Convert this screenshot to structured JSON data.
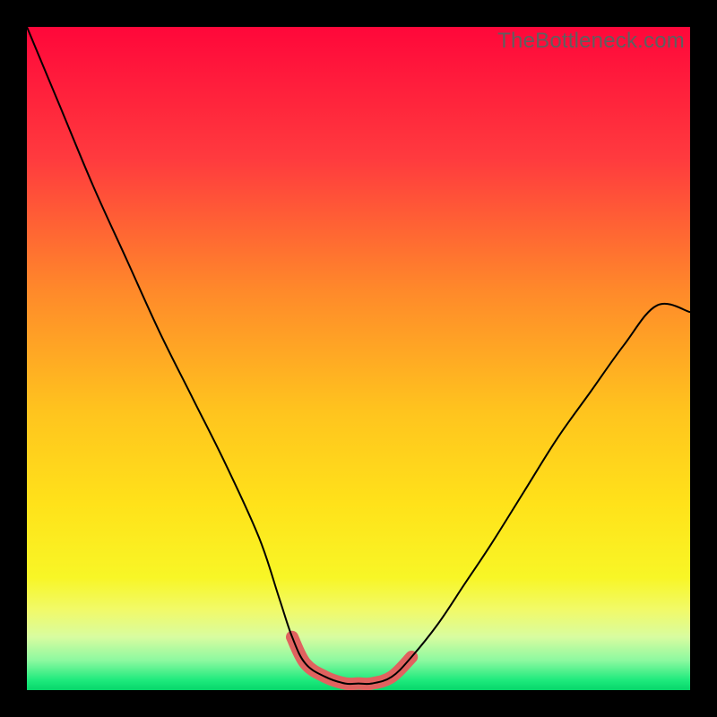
{
  "watermark": "TheBottleneck.com",
  "chart_data": {
    "type": "line",
    "title": "",
    "xlabel": "",
    "ylabel": "",
    "xlim": [
      0,
      100
    ],
    "ylim": [
      0,
      100
    ],
    "grid": false,
    "legend": false,
    "annotations": [],
    "series": [
      {
        "name": "bottleneck-curve",
        "color": "#000000",
        "x": [
          0,
          5,
          10,
          15,
          20,
          25,
          30,
          35,
          38,
          40,
          42,
          45,
          48,
          50,
          52,
          55,
          58,
          62,
          66,
          70,
          75,
          80,
          85,
          90,
          95,
          100
        ],
        "y": [
          100,
          88,
          76,
          65,
          54,
          44,
          34,
          23,
          14,
          8,
          4,
          2,
          1,
          1,
          1,
          2,
          5,
          10,
          16,
          22,
          30,
          38,
          45,
          52,
          58,
          57
        ]
      },
      {
        "name": "flat-bottom-highlight",
        "color": "#e0625f",
        "x": [
          40,
          42,
          45,
          48,
          50,
          52,
          55,
          58
        ],
        "y": [
          8,
          4,
          2,
          1,
          1,
          1,
          2,
          5
        ]
      }
    ],
    "background_gradient_stops": [
      {
        "offset": 0.0,
        "color": "#ff073a"
      },
      {
        "offset": 0.2,
        "color": "#ff3b3e"
      },
      {
        "offset": 0.4,
        "color": "#ff8a2a"
      },
      {
        "offset": 0.58,
        "color": "#ffc41e"
      },
      {
        "offset": 0.72,
        "color": "#ffe21a"
      },
      {
        "offset": 0.83,
        "color": "#f8f626"
      },
      {
        "offset": 0.88,
        "color": "#f1fa6a"
      },
      {
        "offset": 0.92,
        "color": "#d8fca0"
      },
      {
        "offset": 0.955,
        "color": "#8df9a0"
      },
      {
        "offset": 0.985,
        "color": "#1eea7d"
      },
      {
        "offset": 1.0,
        "color": "#07d66a"
      }
    ]
  }
}
